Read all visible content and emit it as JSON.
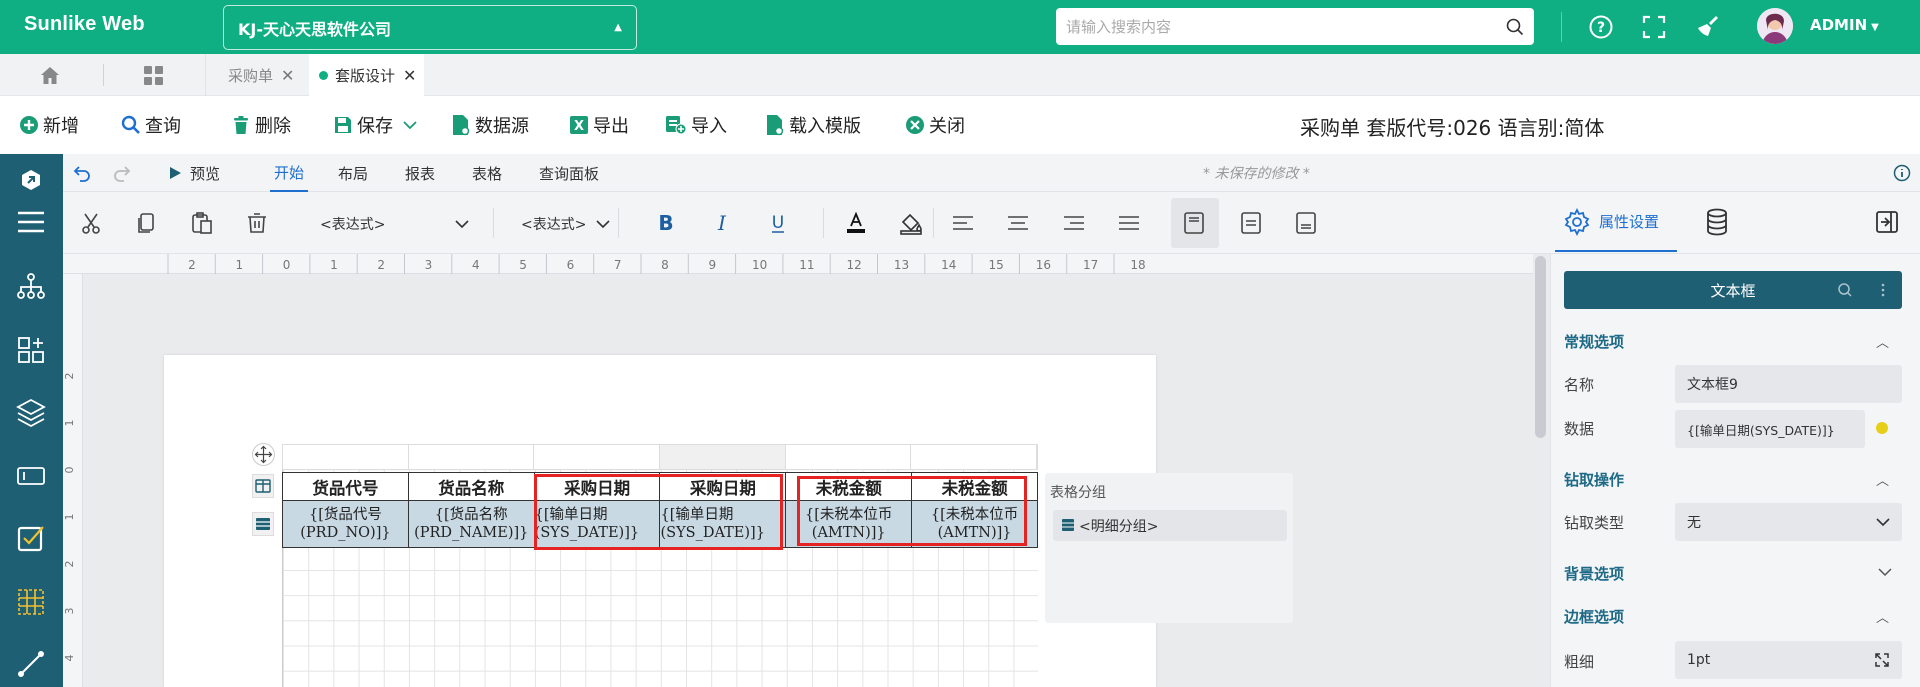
{
  "app": {
    "logo": "Sunlike Web",
    "company": "KJ-天心天思软件公司",
    "search_placeholder": "请输入搜索内容",
    "user": "ADMIN"
  },
  "tabs": [
    {
      "label": "采购单"
    },
    {
      "label": "套版设计"
    }
  ],
  "actions": [
    "新增",
    "查询",
    "删除",
    "保存",
    "数据源",
    "导出",
    "导入",
    "载入模版",
    "关闭"
  ],
  "doc_title": "采购单 套版代号:026 语言别:简体",
  "ribbon": {
    "preview": "预览",
    "tabs": [
      "开始",
      "布局",
      "报表",
      "表格",
      "查询面板"
    ],
    "unsaved": "* 未保存的修改 *"
  },
  "format": {
    "expr1": "<表达式>",
    "expr2": "<表达式>"
  },
  "ruler": {
    "h_ticks": [
      "2",
      "1",
      "0",
      "1",
      "2",
      "3",
      "4",
      "5",
      "6",
      "7",
      "8",
      "9",
      "10",
      "11",
      "12",
      "13",
      "14",
      "15",
      "16",
      "17",
      "18"
    ],
    "v_ticks": [
      "2",
      "1",
      "0",
      "1",
      "2",
      "3",
      "4"
    ]
  },
  "table": {
    "headers": [
      "货品代号",
      "货品名称",
      "采购日期",
      "采购日期",
      "未税金额",
      "未税金额"
    ],
    "details": [
      [
        "{[货品代号",
        "(PRD_NO)]}"
      ],
      [
        "{[货品名称",
        "(PRD_NAME)]}"
      ],
      [
        "{[输单日期",
        "(SYS_DATE)]}"
      ],
      [
        "{[输单日期",
        "(SYS_DATE)]}"
      ],
      [
        "{[未税本位币",
        "(AMTN)]}"
      ],
      [
        "{[未税本位币",
        "(AMTN)]}"
      ]
    ]
  },
  "group_panel": {
    "title": "表格分组",
    "item": "<明细分组>"
  },
  "props": {
    "tab_label": "属性设置",
    "header": "文本框",
    "sections": {
      "general": "常规选项",
      "drill": "钻取操作",
      "background": "背景选项",
      "border": "边框选项"
    },
    "name_label": "名称",
    "name_value": "文本框9",
    "data_label": "数据",
    "data_value": "{[输单日期(SYS_DATE)]}",
    "drill_type_label": "钻取类型",
    "drill_type_value": "无",
    "thickness_label": "粗细",
    "thickness_value": "1pt"
  },
  "colors": {
    "brand": "#0faf83",
    "nav": "#1e5f73",
    "accent": "#1e6fd0",
    "highlight": "#e52323"
  }
}
